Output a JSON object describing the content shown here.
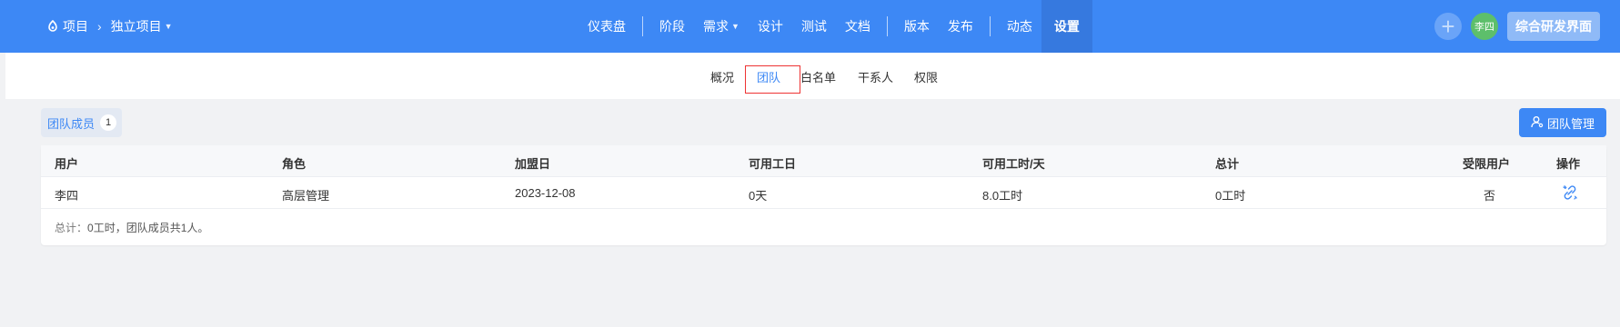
{
  "topbar": {
    "breadcrumb": {
      "root_label": "项目",
      "project_label": "独立项目"
    },
    "nav": [
      {
        "label": "仪表盘"
      },
      {
        "label": "阶段"
      },
      {
        "label": "需求"
      },
      {
        "label": "设计"
      },
      {
        "label": "测试"
      },
      {
        "label": "文档"
      },
      {
        "label": "版本"
      },
      {
        "label": "发布"
      },
      {
        "label": "动态"
      },
      {
        "label": "设置"
      }
    ],
    "avatar_text": "李四",
    "workspace_label": "综合研发界面",
    "accent_color": "#3d88f5"
  },
  "subtabs": [
    {
      "label": "概况"
    },
    {
      "label": "团队"
    },
    {
      "label": "白名单"
    },
    {
      "label": "干系人"
    },
    {
      "label": "权限"
    }
  ],
  "members": {
    "chip_label": "团队成员",
    "chip_count": "1",
    "manage_button": "团队管理"
  },
  "table": {
    "headers": {
      "user": "用户",
      "role": "角色",
      "join_date": "加盟日",
      "available_days": "可用工日",
      "hours_per_day": "可用工时/天",
      "total": "总计",
      "restricted": "受限用户",
      "actions": "操作"
    },
    "rows": [
      {
        "user": "李四",
        "role": "高层管理",
        "join_date": "2023-12-08",
        "available_days": "0天",
        "hours_per_day": "8.0工时",
        "total": "0工时",
        "restricted": "否",
        "action_icon": "unlink-icon"
      }
    ],
    "summary_prefix": "总计：",
    "summary_text": "0工时，团队成员共1人。"
  }
}
